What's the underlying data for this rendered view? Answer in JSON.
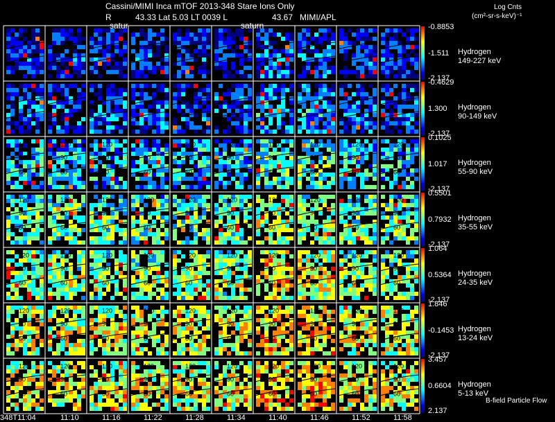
{
  "header": {
    "title": "Cassini/MIMI Inca mTOF  2013-348    Stare    Ions Only",
    "r_label": "R",
    "coords": "43.33 Lat 5.03 LT 0039 L",
    "l_value": "43.67",
    "institution": "MIMI/APL",
    "saturn_label_1": "satur",
    "saturn_label_2": "saturn"
  },
  "colorbar_title": {
    "line1": "Log Cnts",
    "line2": "(cm²-sr-s-keV)⁻¹"
  },
  "footer": {
    "bfield_label": "B-field Particle Flow"
  },
  "time_labels": [
    "348T11:04",
    "11:10",
    "11:16",
    "11:22",
    "11:28",
    "11:34",
    "11:40",
    "11:46",
    "11:52",
    "11:58"
  ],
  "contour_labels": [
    "30",
    "60",
    "90",
    "120"
  ],
  "chart_data": {
    "type": "heatmap",
    "title": "Cassini/MIMI Inca mTOF  2013-348    Stare    Ions Only",
    "xlabel": "",
    "x": [
      "348T11:04",
      "11:10",
      "11:16",
      "11:22",
      "11:28",
      "11:34",
      "11:40",
      "11:46",
      "11:52",
      "11:58"
    ],
    "colorbar_unit": "Log Cnts (cm²-sr-s-keV)⁻¹",
    "colormap": [
      "#000080",
      "#0000ff",
      "#0080ff",
      "#00ffff",
      "#80ff80",
      "#ffff00",
      "#ff8000",
      "#ff0000"
    ],
    "series": [
      {
        "name": "Hydrogen",
        "energy": "149-227 keV",
        "max": "-0.8853",
        "mid": "-1.511",
        "min": "-2.137",
        "level": 0.18
      },
      {
        "name": "Hydrogen",
        "energy": "90-149 keV",
        "max": "-0.4629",
        "mid": "1.300",
        "min": "-2.137",
        "level": 0.25
      },
      {
        "name": "Hydrogen",
        "energy": "55-90 keV",
        "max": "0.1025",
        "mid": "1.017",
        "min": "-2.137",
        "level": 0.42
      },
      {
        "name": "Hydrogen",
        "energy": "35-55 keV",
        "max": "0.5501",
        "mid": "0.7932",
        "min": "-2.137",
        "level": 0.55
      },
      {
        "name": "Hydrogen",
        "energy": "24-35 keV",
        "max": "1.064",
        "mid": "0.5364",
        "min": "-2.137",
        "level": 0.62
      },
      {
        "name": "Hydrogen",
        "energy": "13-24 keV",
        "max": "1.846",
        "mid": "-0.1453",
        "min": "-2.137",
        "level": 0.7
      },
      {
        "name": "Hydrogen",
        "energy": "5-13 keV",
        "max": "3.457",
        "mid": "0.6604",
        "min": "2.137",
        "level": 0.72
      }
    ]
  }
}
